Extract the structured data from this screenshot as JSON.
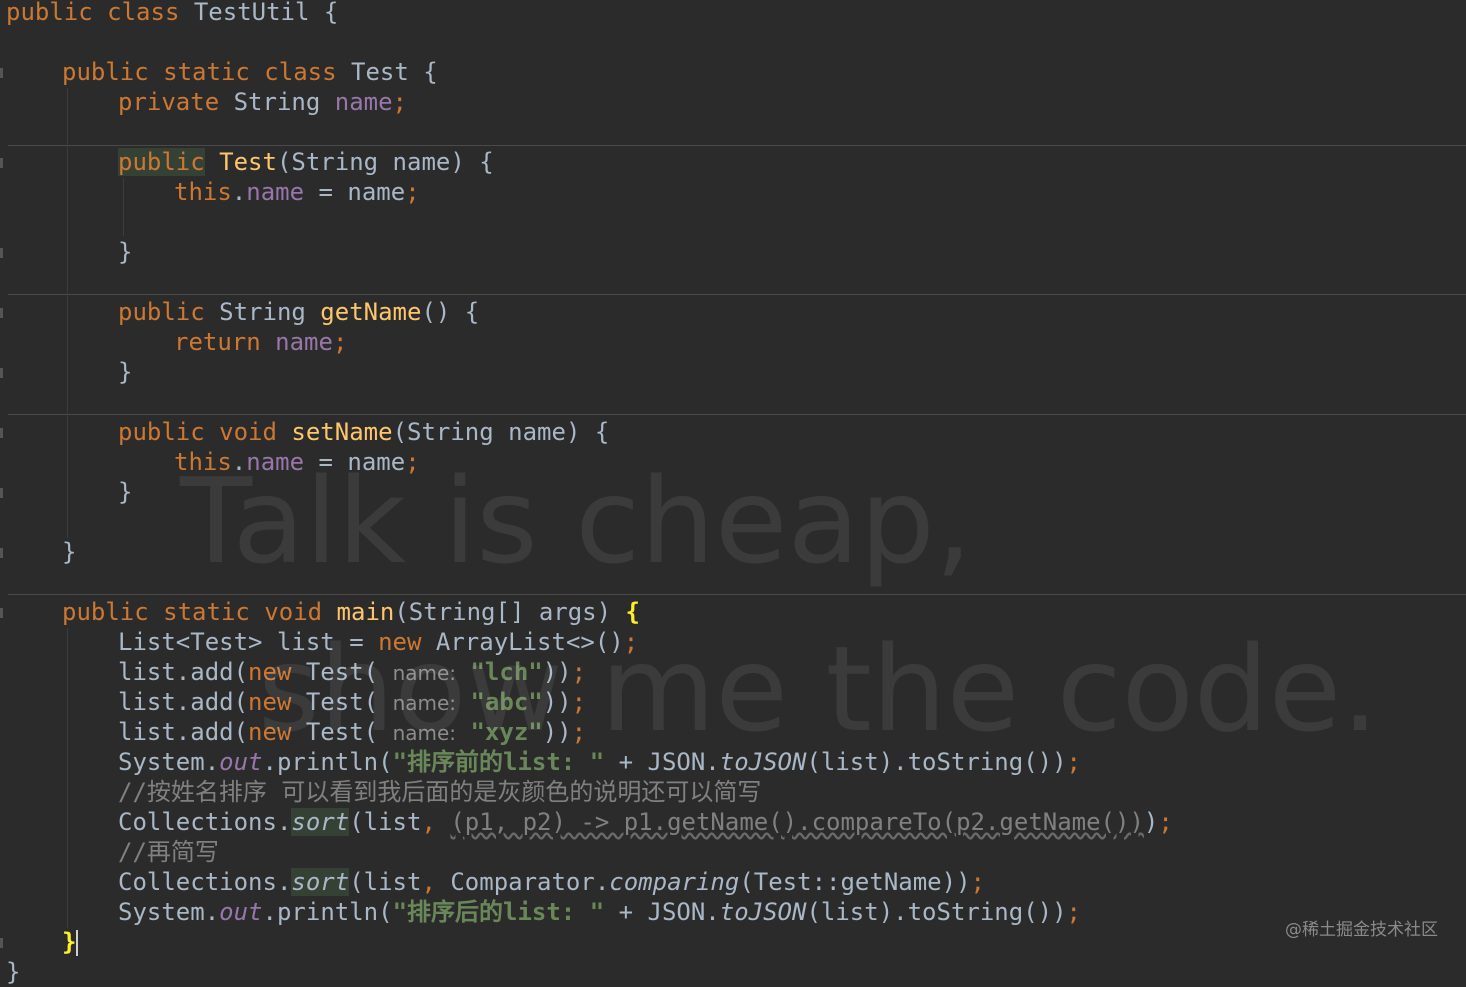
{
  "colors": {
    "background": "#2b2b2b",
    "keyword": "#cc7832",
    "method_decl": "#ffc66d",
    "field": "#9876aa",
    "string": "#6a8759",
    "comment": "#808080",
    "plain": "#a9b7c6"
  },
  "code": {
    "l1": {
      "kw1": "public class",
      "name": " TestUtil {"
    },
    "l2": {
      "kw1": "public static class",
      "name": " Test {"
    },
    "l3": {
      "kw1": "private",
      "type": " String ",
      "field": "name",
      "semi": ";"
    },
    "l4": {
      "kw1": "public",
      "fn": "Test",
      "rest": "(String name) {"
    },
    "l5": {
      "kw1": "this",
      "dot": ".",
      "field": "name",
      "rest": " = name",
      "semi": ";"
    },
    "l6": {
      "brace": "}"
    },
    "l7": {
      "kw1": "public",
      "type": " String ",
      "fn": "getName",
      "rest": "() {"
    },
    "l8": {
      "kw1": "return",
      "sp": " ",
      "field": "name",
      "semi": ";"
    },
    "l9": {
      "brace": "}"
    },
    "l10": {
      "kw1": "public void",
      "sp": " ",
      "fn": "setName",
      "rest": "(String name) {"
    },
    "l11": {
      "kw1": "this",
      "dot": ".",
      "field": "name",
      "rest": " = name",
      "semi": ";"
    },
    "l12": {
      "brace": "}"
    },
    "l13": {
      "brace": "}"
    },
    "l14": {
      "kw1": "public static void",
      "sp": " ",
      "fn": "main",
      "rest": "(String[] args) ",
      "brace": "{"
    },
    "l15": {
      "a": "List<Test> list = ",
      "kw1": "new",
      "b": " ArrayList<>()",
      "semi": ";"
    },
    "l16": {
      "a": "list.add(",
      "kw1": "new",
      "b": " Test( ",
      "hint": "name:",
      "c": " ",
      "str": "\"lch\"",
      "d": "))",
      "semi": ";"
    },
    "l17": {
      "a": "list.add(",
      "kw1": "new",
      "b": " Test( ",
      "hint": "name:",
      "c": " ",
      "str": "\"abc\"",
      "d": "))",
      "semi": ";"
    },
    "l18": {
      "a": "list.add(",
      "kw1": "new",
      "b": " Test( ",
      "hint": "name:",
      "c": " ",
      "str": "\"xyz\"",
      "d": "))",
      "semi": ";"
    },
    "l19": {
      "a": "System.",
      "stat": "out",
      "b": ".println(",
      "str": "\"排序前的list: \"",
      "c": " + JSON.",
      "it": "toJSON",
      "d": "(list).toString())",
      "semi": ";"
    },
    "l20": {
      "cmt": "//按姓名排序 可以看到我后面的是灰颜色的说明还可以简写"
    },
    "l21": {
      "a": "Collections.",
      "it": "sort",
      "b": "(list",
      "comma": ",",
      "sp": " ",
      "lambda": "(p1, p2) -> p1.getName().compareTo(p2.getName())",
      "c": ")",
      "semi": ";"
    },
    "l22": {
      "cmt": "//再简写"
    },
    "l23": {
      "a": "Collections.",
      "it": "sort",
      "b": "(list",
      "comma": ",",
      "c": " Comparator.",
      "it2": "comparing",
      "d": "(Test::getName))",
      "semi": ";"
    },
    "l24": {
      "a": "System.",
      "stat": "out",
      "b": ".println(",
      "str": "\"排序后的list: \"",
      "c": " + JSON.",
      "it": "toJSON",
      "d": "(list).toString())",
      "semi": ";"
    },
    "l25": {
      "brace": "}"
    },
    "l26": {
      "brace": "}"
    }
  },
  "watermark": {
    "line1": "Talk is cheap,",
    "line2": "show me the code."
  },
  "credit": "@稀土掘金技术社区"
}
